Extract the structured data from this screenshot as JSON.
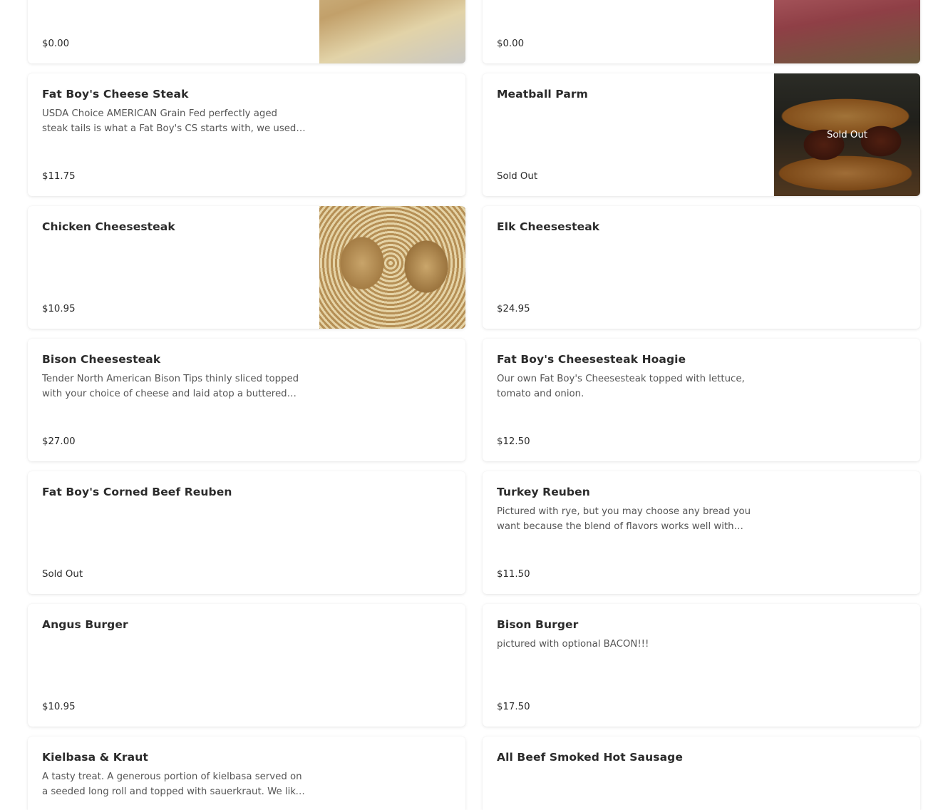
{
  "menu_items": [
    {
      "name": "",
      "description": "",
      "price": "$0.00",
      "image": "photo-sandwich-top",
      "sold_out_overlay": ""
    },
    {
      "name": "",
      "description": "",
      "price": "$0.00",
      "image": "photo-roastbeef",
      "sold_out_overlay": ""
    },
    {
      "name": "Fat Boy's Cheese Steak",
      "description": "USDA Choice AMERICAN Grain Fed perfectly aged steak tails is what a Fat Boy's CS starts with, we used ...",
      "price": "$11.75",
      "image": "",
      "sold_out_overlay": ""
    },
    {
      "name": "Meatball Parm",
      "description": "",
      "price": "Sold Out",
      "image": "photo-meatball",
      "sold_out_overlay": "Sold Out"
    },
    {
      "name": "Chicken Cheesesteak",
      "description": "",
      "price": "$10.95",
      "image": "photo-chicken",
      "sold_out_overlay": ""
    },
    {
      "name": "Elk Cheesesteak",
      "description": "",
      "price": "$24.95",
      "image": "",
      "sold_out_overlay": ""
    },
    {
      "name": "Bison Cheesesteak",
      "description": "Tender North American Bison Tips thinly sliced topped with your choice of cheese and laid atop a buttered an...",
      "price": "$27.00",
      "image": "",
      "sold_out_overlay": ""
    },
    {
      "name": "Fat Boy's Cheesesteak Hoagie",
      "description": "Our own Fat Boy's Cheesesteak topped with lettuce, tomato and onion.",
      "price": "$12.50",
      "image": "",
      "sold_out_overlay": ""
    },
    {
      "name": "Fat Boy's Corned Beef Reuben",
      "description": "",
      "price": "Sold Out",
      "image": "",
      "sold_out_overlay": ""
    },
    {
      "name": "Turkey Reuben",
      "description": "Pictured with rye, but you may choose any bread you want because the blend of flavors works well with ever...",
      "price": "$11.50",
      "image": "",
      "sold_out_overlay": ""
    },
    {
      "name": "Angus Burger",
      "description": "",
      "price": "$10.95",
      "image": "",
      "sold_out_overlay": ""
    },
    {
      "name": "Bison Burger",
      "description": "pictured with optional BACON!!!",
      "price": "$17.50",
      "image": "",
      "sold_out_overlay": ""
    },
    {
      "name": "Kielbasa & Kraut",
      "description": "A tasty treat. A generous portion of kielbasa served on a seeded long roll and topped with sauerkraut. We like i...",
      "price": "",
      "image": "",
      "sold_out_overlay": ""
    },
    {
      "name": "All Beef Smoked Hot Sausage",
      "description": "",
      "price": "",
      "image": "",
      "sold_out_overlay": ""
    }
  ]
}
